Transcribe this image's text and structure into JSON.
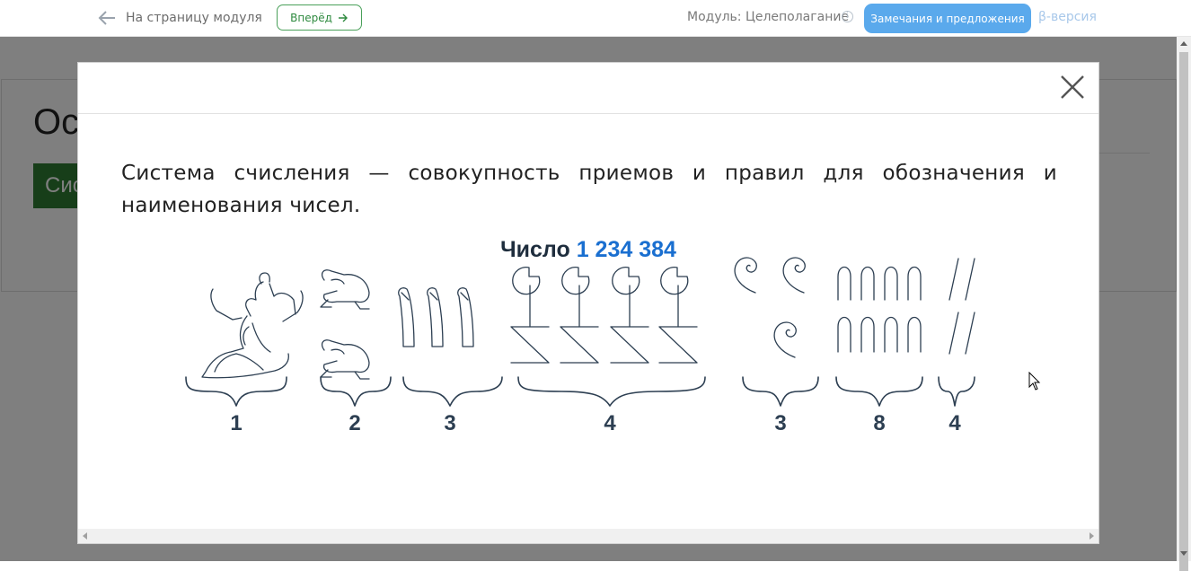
{
  "topbar": {
    "back_label": "На страницу модуля",
    "forward_label": "Вперёд",
    "module_label": "Модуль: Целеполагание",
    "info_icon": "info-icon",
    "feedback_label": "Замечания и предложения",
    "beta_label": "β-версия"
  },
  "background": {
    "title_fragment": "Ос",
    "button_fragment": "Сис"
  },
  "modal": {
    "close_icon": "close-icon",
    "definition": "Система счисления — совокупность приемов и правил для обозначения и наименования чисел.",
    "figure": {
      "title_word": "Число",
      "title_number": "1 234 384",
      "groups": [
        {
          "glyph": "kneeling-man-hieroglyph",
          "count": "1"
        },
        {
          "glyph": "frog-hieroglyph",
          "count": "2"
        },
        {
          "glyph": "finger-hieroglyph",
          "count": "3"
        },
        {
          "glyph": "lotus-hieroglyph",
          "count": "4"
        },
        {
          "glyph": "coil-rope-hieroglyph",
          "count": "3"
        },
        {
          "glyph": "heel-bone-hieroglyph",
          "count": "8"
        },
        {
          "glyph": "stroke-hieroglyph",
          "count": "4"
        }
      ]
    }
  },
  "colors": {
    "accent_blue": "#5aa9ec",
    "forward_green": "#2e8a3f",
    "number_blue": "#1a6fd0",
    "glyph_stroke": "#2d3f52"
  }
}
